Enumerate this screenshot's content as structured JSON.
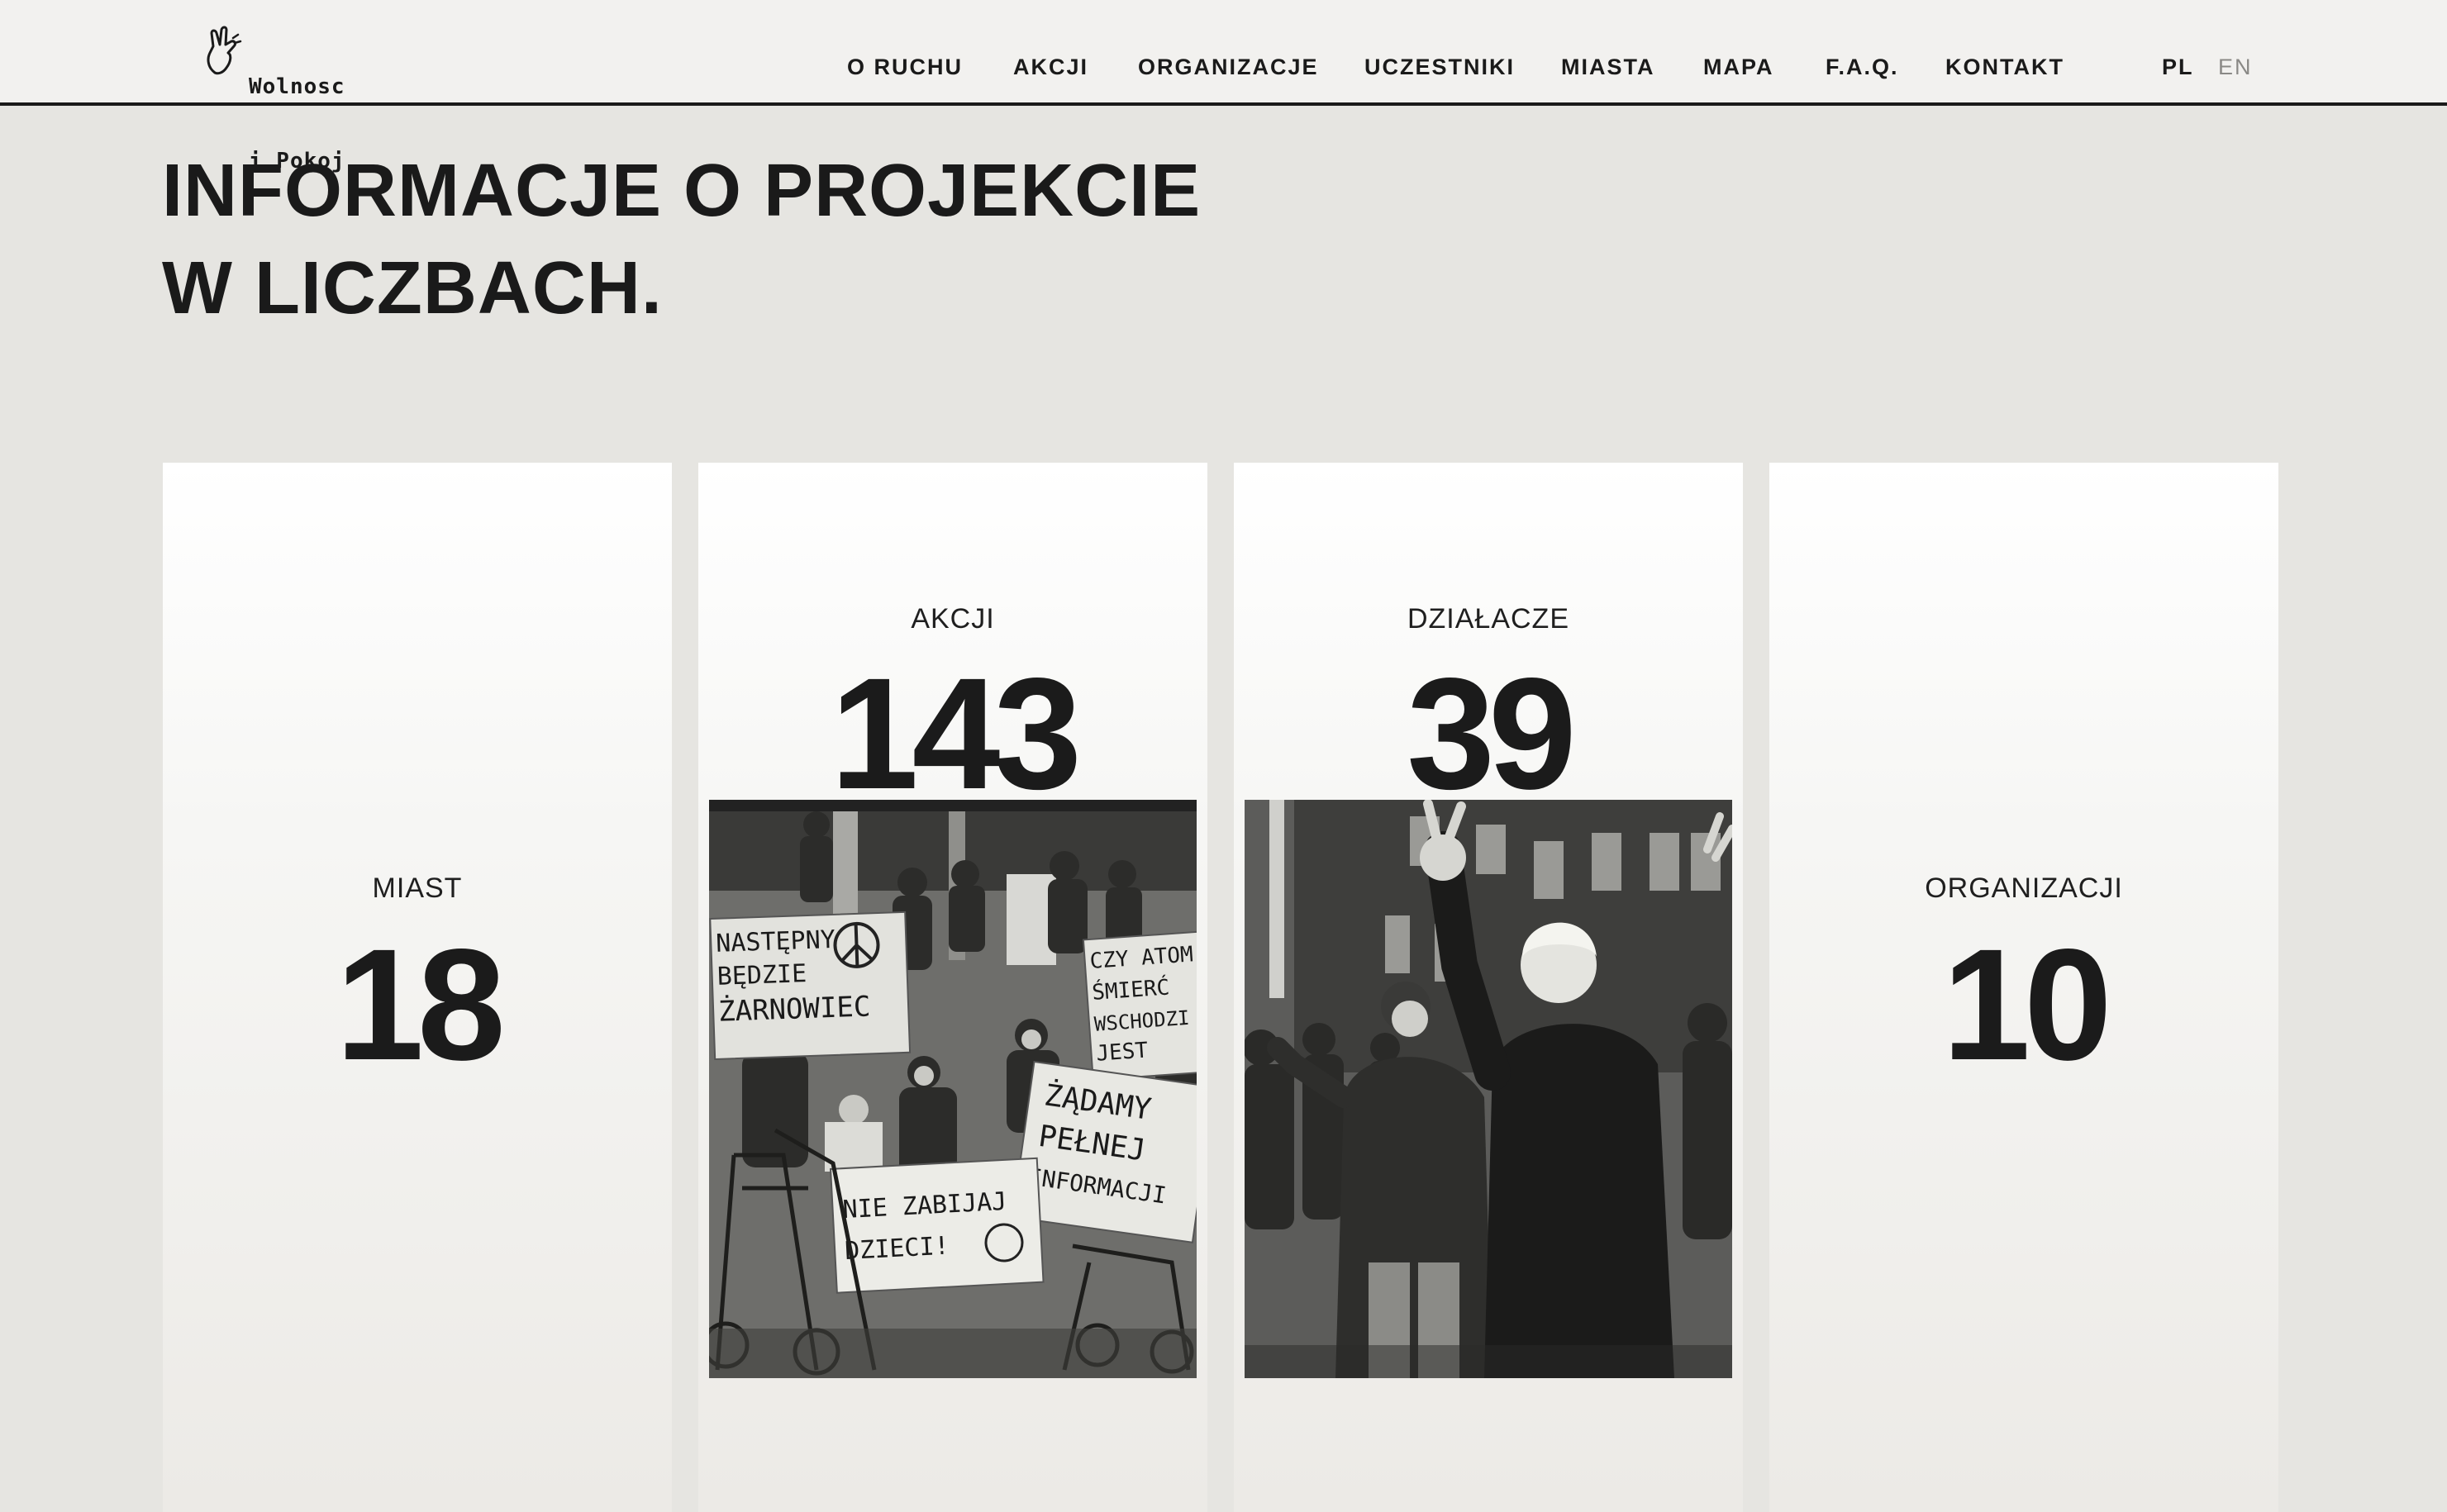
{
  "header": {
    "logo": {
      "line1": "Wolnosc",
      "line2": "i Pokoj"
    },
    "nav": [
      {
        "label": "O RUCHU"
      },
      {
        "label": "AKCJI"
      },
      {
        "label": "ORGANIZACJE"
      },
      {
        "label": "UCZESTNIKI"
      },
      {
        "label": "MIASTA"
      },
      {
        "label": "MAPA"
      },
      {
        "label": "F.A.Q."
      },
      {
        "label": "KONTAKT"
      }
    ],
    "languages": [
      {
        "label": "PL",
        "active": true
      },
      {
        "label": "EN",
        "active": false
      }
    ]
  },
  "page": {
    "title_line1": "INFORMACJE O PROJEKCIE",
    "title_line2": "W LICZBACH."
  },
  "stats": [
    {
      "label": "MIAST",
      "value": "18"
    },
    {
      "label": "AKCJI",
      "value": "143"
    },
    {
      "label": "DZIAŁACZE",
      "value": "39"
    },
    {
      "label": "ORGANIZACJI",
      "value": "10"
    }
  ],
  "photos": {
    "protest": {
      "signs": [
        "NASTĘPNY",
        "BĘDZIE",
        "ŻARNOWIEC",
        "CZY ATOM",
        "ŚMIERĆ",
        "WSCHODZI",
        "JEST",
        "ŻĄDAMY",
        "PEŁNEJ",
        "INFORMACJI",
        "NIE ZABIJAJ",
        "DZIECI!"
      ]
    }
  },
  "colors": {
    "background": "#e6e5e1",
    "header_bg": "#f2f1ef",
    "text": "#1a1a1a",
    "muted": "#8a8986"
  }
}
